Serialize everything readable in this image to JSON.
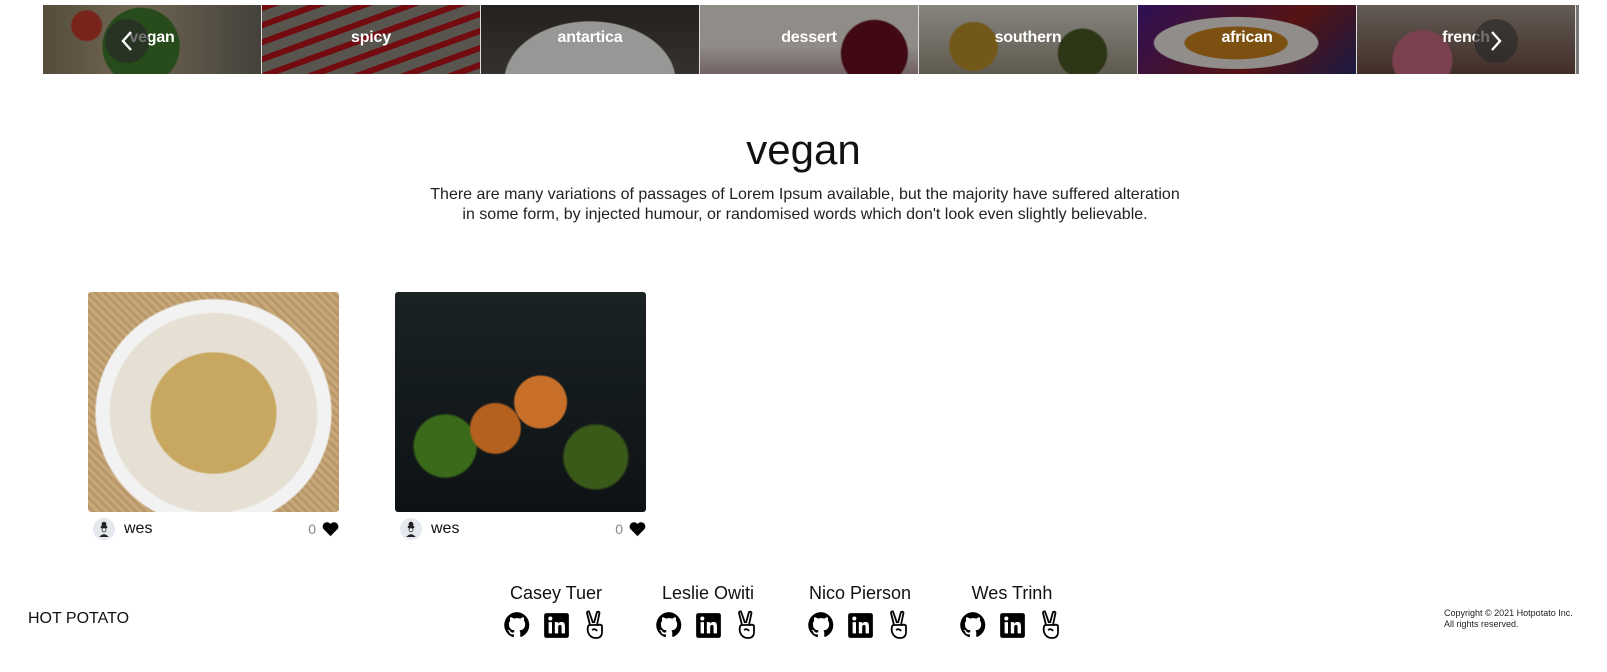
{
  "carousel": {
    "categories": [
      {
        "label": "vegan"
      },
      {
        "label": "spicy"
      },
      {
        "label": "antartica"
      },
      {
        "label": "dessert"
      },
      {
        "label": "southern"
      },
      {
        "label": "african"
      },
      {
        "label": "french"
      }
    ],
    "prev_icon": "chevron-left-icon",
    "next_icon": "chevron-right-icon"
  },
  "page": {
    "title": "vegan",
    "description": "There are many variations of passages of Lorem Ipsum available, but the majority have suffered alteration in some form, by injected humour, or randomised words which don't look even slightly believable."
  },
  "recipes": [
    {
      "image": "fries-photo",
      "author": "wes",
      "likes": "0"
    },
    {
      "image": "tofu-broccoli-photo",
      "author": "wes",
      "likes": "0"
    }
  ],
  "footer": {
    "brand": "HOT POTATO",
    "team": [
      {
        "name": "Casey Tuer"
      },
      {
        "name": "Leslie Owiti"
      },
      {
        "name": "Nico Pierson"
      },
      {
        "name": "Wes Trinh"
      }
    ],
    "copyright_line1": "Copyright © 2021 Hotpotato Inc.",
    "copyright_line2": "All rights reserved."
  }
}
